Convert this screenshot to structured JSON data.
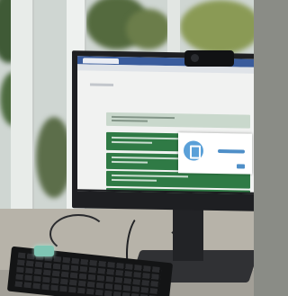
{
  "photo": {
    "subject": "desktop-monitor-photo",
    "colors": {
      "task_green": "#2f7a45",
      "dialog_blue": "#5aa0d8",
      "browser_blue": "#3a5c9c",
      "desk": "#b7b3a9"
    },
    "icons": [
      "webcam-icon",
      "edit-icon",
      "keyboard-icon",
      "usb-device-icon"
    ]
  }
}
